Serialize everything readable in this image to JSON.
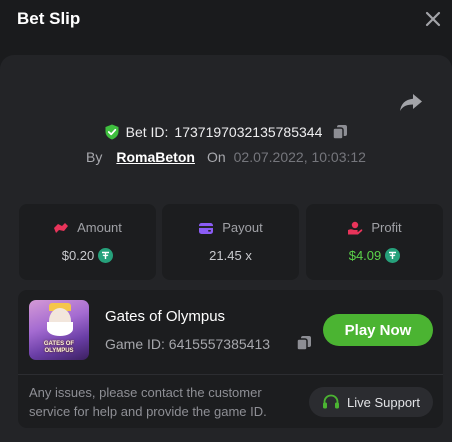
{
  "header": {
    "title": "Bet Slip"
  },
  "bet": {
    "id_label": "Bet ID:",
    "id_value": "1737197032135785344",
    "by_label": "By",
    "username": "RomaBeton",
    "on_label": "On",
    "datetime": "02.07.2022, 10:03:12"
  },
  "stats": [
    {
      "label": "Amount",
      "value": "$0.20",
      "icon": "stake-icon",
      "icon_color": "#e8345a",
      "currency_icon": "tether-icon"
    },
    {
      "label": "Payout",
      "value": "21.45 x",
      "icon": "wallet-icon",
      "icon_color": "#8b5cf6"
    },
    {
      "label": "Profit",
      "value": "$4.09",
      "icon": "profit-hand-icon",
      "icon_color": "#e8345a",
      "value_color": "#5bd34a",
      "currency_icon": "tether-icon"
    }
  ],
  "game": {
    "thumbnail_text": "GATES OF OLYMPUS",
    "name": "Gates of Olympus",
    "id_label": "Game ID:",
    "id_value": "6415557385413",
    "play_label": "Play Now"
  },
  "support": {
    "text": "Any issues, please contact the customer service for help and provide the game ID.",
    "button_label": "Live Support"
  },
  "colors": {
    "background": "#1a1b1d",
    "panel": "#232427",
    "card": "#1c1d1f",
    "accent_green": "#4bb432",
    "tether": "#26a17b",
    "verified": "#3fbf3f"
  }
}
